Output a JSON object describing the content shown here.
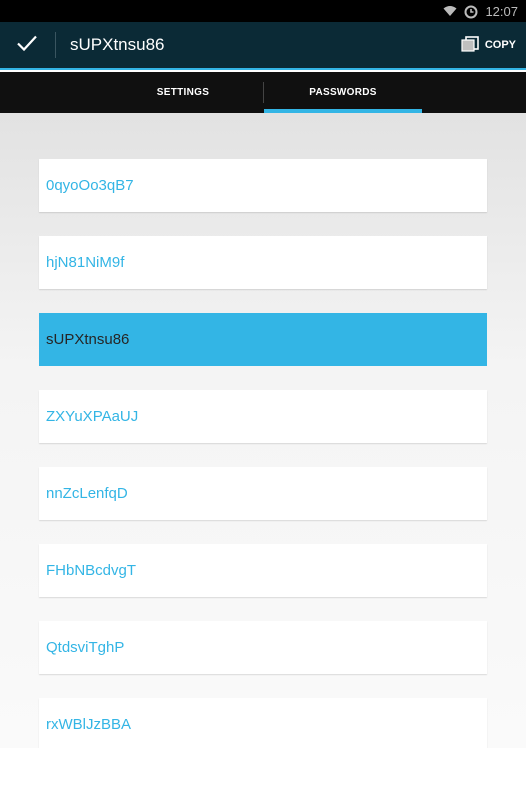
{
  "status_bar": {
    "time": "12:07",
    "icons": [
      "wifi-icon",
      "alarm-icon"
    ]
  },
  "action_bar": {
    "title": "sUPXtnsu86",
    "done_icon": "checkmark-icon",
    "copy_label": "COPY",
    "copy_icon": "copy-icon"
  },
  "tabs": [
    {
      "label": "SETTINGS",
      "active": false
    },
    {
      "label": "PASSWORDS",
      "active": true
    }
  ],
  "passwords": {
    "selected_index": 2,
    "items": [
      "0qyoOo3qB7",
      "hjN81NiM9f",
      "sUPXtnsu86",
      "ZXYuXPAaUJ",
      "nnZcLenfqD",
      "FHbNBcdvgT",
      "QtdsviTghP",
      "rxWBlJzBBA"
    ]
  },
  "colors": {
    "accent": "#33b5e5",
    "action_bar": "#0b2a36",
    "tab_bar": "#101010"
  }
}
